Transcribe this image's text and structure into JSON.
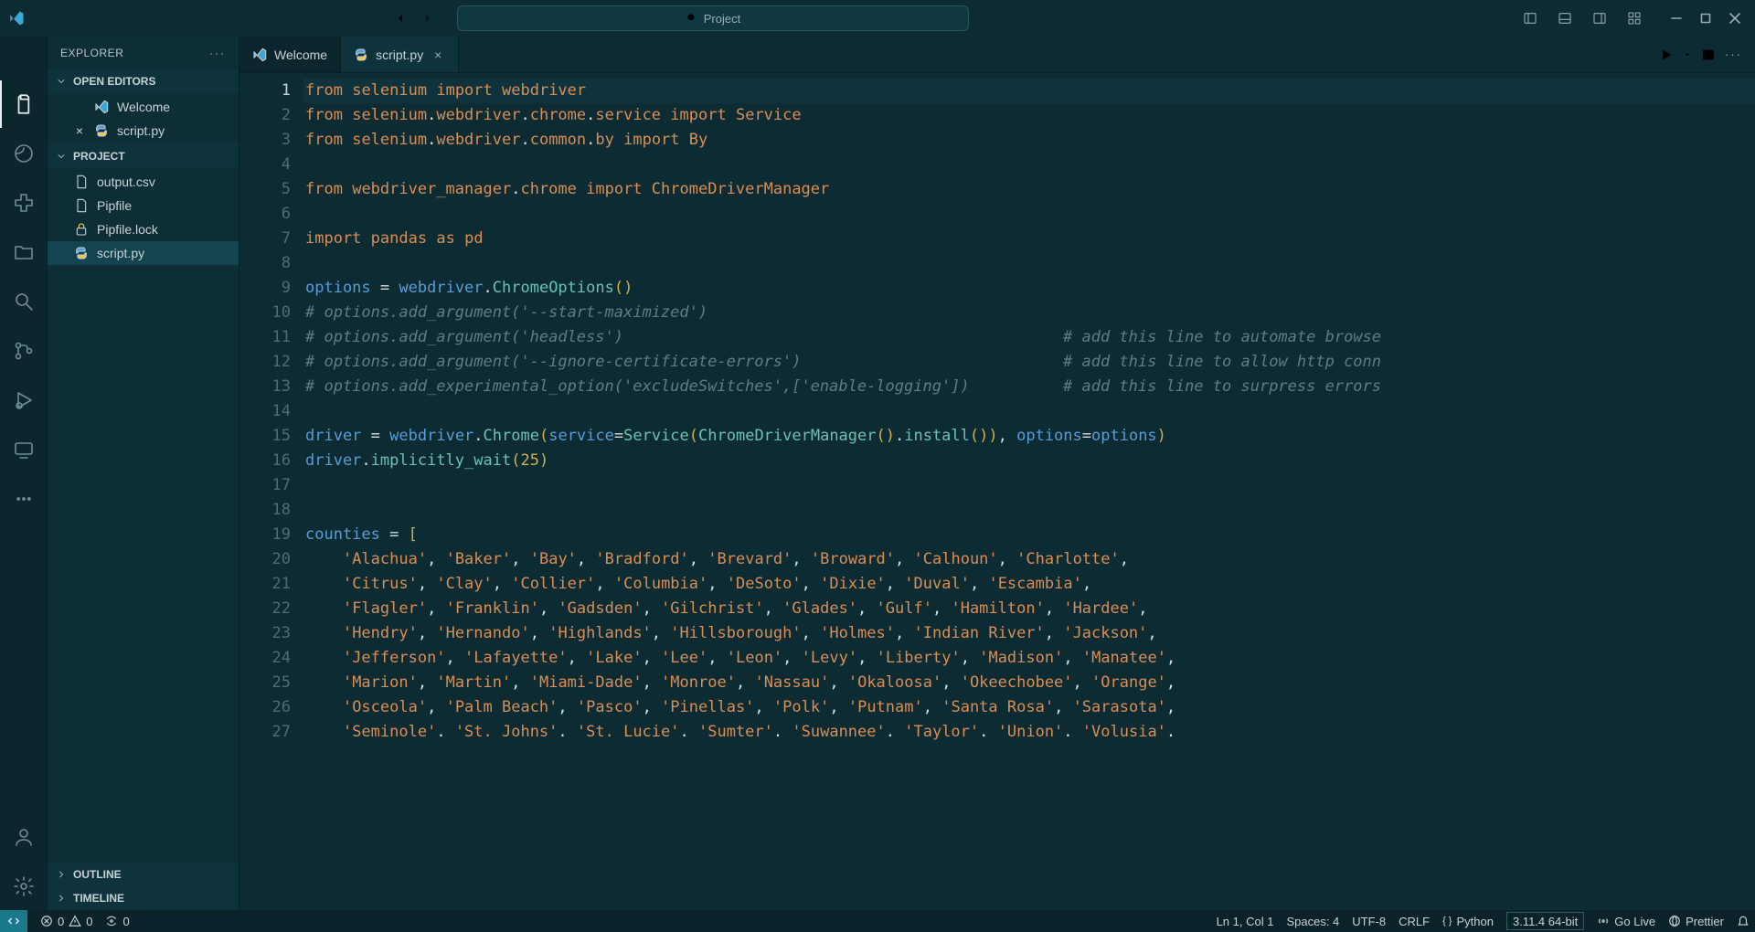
{
  "title_search_placeholder": "Project",
  "tabs": [
    {
      "label": "Welcome",
      "icon": "vscode",
      "active": false,
      "dirty": false
    },
    {
      "label": "script.py",
      "icon": "python",
      "active": true,
      "dirty": false
    }
  ],
  "sidebar": {
    "title": "EXPLORER",
    "sections": {
      "open_editors": {
        "label": "OPEN EDITORS",
        "items": [
          {
            "label": "Welcome",
            "icon": "vscode",
            "closable": false
          },
          {
            "label": "script.py",
            "icon": "python",
            "closable": true
          }
        ]
      },
      "project": {
        "label": "PROJECT",
        "items": [
          {
            "label": "output.csv",
            "icon": "csv"
          },
          {
            "label": "Pipfile",
            "icon": "pipfile"
          },
          {
            "label": "Pipfile.lock",
            "icon": "lock"
          },
          {
            "label": "script.py",
            "icon": "python",
            "active": true
          }
        ]
      },
      "outline": {
        "label": "OUTLINE"
      },
      "timeline": {
        "label": "TIMELINE"
      }
    }
  },
  "activity": {
    "items": [
      "menu",
      "explorer",
      "edge",
      "python",
      "folder",
      "search",
      "scm",
      "debug",
      "remote",
      "more"
    ],
    "bottom": [
      "account",
      "settings"
    ]
  },
  "editor": {
    "current_line": 1,
    "lines": [
      {
        "n": 1,
        "html": "<span class='kw'>from</span> <span class='mod'>selenium</span> <span class='kw'>import</span> <span class='mod'>webdriver</span>"
      },
      {
        "n": 2,
        "html": "<span class='kw'>from</span> <span class='mod'>selenium</span><span class='op'>.</span><span class='mod'>webdriver</span><span class='op'>.</span><span class='mod'>chrome</span><span class='op'>.</span><span class='mod'>service</span> <span class='kw'>import</span> <span class='mod'>Service</span>"
      },
      {
        "n": 3,
        "html": "<span class='kw'>from</span> <span class='mod'>selenium</span><span class='op'>.</span><span class='mod'>webdriver</span><span class='op'>.</span><span class='mod'>common</span><span class='op'>.</span><span class='mod'>by</span> <span class='kw'>import</span> <span class='mod'>By</span>"
      },
      {
        "n": 4,
        "html": ""
      },
      {
        "n": 5,
        "html": "<span class='kw'>from</span> <span class='mod'>webdriver_manager</span><span class='op'>.</span><span class='mod'>chrome</span> <span class='kw'>import</span> <span class='mod'>ChromeDriverManager</span>"
      },
      {
        "n": 6,
        "html": ""
      },
      {
        "n": 7,
        "html": "<span class='kw'>import</span> <span class='mod'>pandas</span> <span class='kw'>as</span> <span class='mod'>pd</span>"
      },
      {
        "n": 8,
        "html": ""
      },
      {
        "n": 9,
        "html": "<span class='name'>options</span> <span class='op'>=</span> <span class='name'>webdriver</span><span class='op'>.</span><span class='func'>ChromeOptions</span><span class='punct'>()</span>"
      },
      {
        "n": 10,
        "html": "<span class='cmt'># options.add_argument('--start-maximized')</span>"
      },
      {
        "n": 11,
        "html": "<span class='cmt'># options.add_argument('headless')                                               # add this line to automate browse</span>"
      },
      {
        "n": 12,
        "html": "<span class='cmt'># options.add_argument('--ignore-certificate-errors')                            # add this line to allow http conn</span>"
      },
      {
        "n": 13,
        "html": "<span class='cmt'># options.add_experimental_option('excludeSwitches',['enable-logging'])          # add this line to surpress errors</span>"
      },
      {
        "n": 14,
        "html": ""
      },
      {
        "n": 15,
        "html": "<span class='name'>driver</span> <span class='op'>=</span> <span class='name'>webdriver</span><span class='op'>.</span><span class='func'>Chrome</span><span class='punct'>(</span><span class='name'>service</span><span class='op'>=</span><span class='func'>Service</span><span class='punct'>(</span><span class='func'>ChromeDriverManager</span><span class='punct'>()</span><span class='op'>.</span><span class='func'>install</span><span class='punct'>())</span><span class='op'>,</span> <span class='name'>options</span><span class='op'>=</span><span class='name'>options</span><span class='punct'>)</span>"
      },
      {
        "n": 16,
        "html": "<span class='name'>driver</span><span class='op'>.</span><span class='func'>implicitly_wait</span><span class='punct'>(</span><span class='num'>25</span><span class='punct'>)</span>"
      },
      {
        "n": 17,
        "html": ""
      },
      {
        "n": 18,
        "html": ""
      },
      {
        "n": 19,
        "html": "<span class='name'>counties</span> <span class='op'>=</span> <span class='punct'>[</span>"
      },
      {
        "n": 20,
        "html": "    <span class='str'>'Alachua'</span><span class='op'>,</span> <span class='str'>'Baker'</span><span class='op'>,</span> <span class='str'>'Bay'</span><span class='op'>,</span> <span class='str'>'Bradford'</span><span class='op'>,</span> <span class='str'>'Brevard'</span><span class='op'>,</span> <span class='str'>'Broward'</span><span class='op'>,</span> <span class='str'>'Calhoun'</span><span class='op'>,</span> <span class='str'>'Charlotte'</span><span class='op'>,</span>"
      },
      {
        "n": 21,
        "html": "    <span class='str'>'Citrus'</span><span class='op'>,</span> <span class='str'>'Clay'</span><span class='op'>,</span> <span class='str'>'Collier'</span><span class='op'>,</span> <span class='str'>'Columbia'</span><span class='op'>,</span> <span class='str'>'DeSoto'</span><span class='op'>,</span> <span class='str'>'Dixie'</span><span class='op'>,</span> <span class='str'>'Duval'</span><span class='op'>,</span> <span class='str'>'Escambia'</span><span class='op'>,</span>"
      },
      {
        "n": 22,
        "html": "    <span class='str'>'Flagler'</span><span class='op'>,</span> <span class='str'>'Franklin'</span><span class='op'>,</span> <span class='str'>'Gadsden'</span><span class='op'>,</span> <span class='str'>'Gilchrist'</span><span class='op'>,</span> <span class='str'>'Glades'</span><span class='op'>,</span> <span class='str'>'Gulf'</span><span class='op'>,</span> <span class='str'>'Hamilton'</span><span class='op'>,</span> <span class='str'>'Hardee'</span><span class='op'>,</span>"
      },
      {
        "n": 23,
        "html": "    <span class='str'>'Hendry'</span><span class='op'>,</span> <span class='str'>'Hernando'</span><span class='op'>,</span> <span class='str'>'Highlands'</span><span class='op'>,</span> <span class='str'>'Hillsborough'</span><span class='op'>,</span> <span class='str'>'Holmes'</span><span class='op'>,</span> <span class='str'>'Indian River'</span><span class='op'>,</span> <span class='str'>'Jackson'</span><span class='op'>,</span>"
      },
      {
        "n": 24,
        "html": "    <span class='str'>'Jefferson'</span><span class='op'>,</span> <span class='str'>'Lafayette'</span><span class='op'>,</span> <span class='str'>'Lake'</span><span class='op'>,</span> <span class='str'>'Lee'</span><span class='op'>,</span> <span class='str'>'Leon'</span><span class='op'>,</span> <span class='str'>'Levy'</span><span class='op'>,</span> <span class='str'>'Liberty'</span><span class='op'>,</span> <span class='str'>'Madison'</span><span class='op'>,</span> <span class='str'>'Manatee'</span><span class='op'>,</span>"
      },
      {
        "n": 25,
        "html": "    <span class='str'>'Marion'</span><span class='op'>,</span> <span class='str'>'Martin'</span><span class='op'>,</span> <span class='str'>'Miami-Dade'</span><span class='op'>,</span> <span class='str'>'Monroe'</span><span class='op'>,</span> <span class='str'>'Nassau'</span><span class='op'>,</span> <span class='str'>'Okaloosa'</span><span class='op'>,</span> <span class='str'>'Okeechobee'</span><span class='op'>,</span> <span class='str'>'Orange'</span><span class='op'>,</span>"
      },
      {
        "n": 26,
        "html": "    <span class='str'>'Osceola'</span><span class='op'>,</span> <span class='str'>'Palm Beach'</span><span class='op'>,</span> <span class='str'>'Pasco'</span><span class='op'>,</span> <span class='str'>'Pinellas'</span><span class='op'>,</span> <span class='str'>'Polk'</span><span class='op'>,</span> <span class='str'>'Putnam'</span><span class='op'>,</span> <span class='str'>'Santa Rosa'</span><span class='op'>,</span> <span class='str'>'Sarasota'</span><span class='op'>,</span>"
      },
      {
        "n": 27,
        "html": "    <span class='str'>'Seminole'</span><span class='op'>.</span> <span class='str'>'St. Johns'</span><span class='op'>.</span> <span class='str'>'St. Lucie'</span><span class='op'>.</span> <span class='str'>'Sumter'</span><span class='op'>.</span> <span class='str'>'Suwannee'</span><span class='op'>.</span> <span class='str'>'Taylor'</span><span class='op'>.</span> <span class='str'>'Union'</span><span class='op'>.</span> <span class='str'>'Volusia'</span><span class='op'>.</span>"
      }
    ]
  },
  "statusbar": {
    "errors": "0",
    "warnings": "0",
    "ports": "0",
    "cursor": "Ln 1, Col 1",
    "spaces": "Spaces: 4",
    "encoding": "UTF-8",
    "eol": "CRLF",
    "lang": "Python",
    "interpreter": "3.11.4 64-bit",
    "golive": "Go Live",
    "formatter": "Prettier"
  },
  "colors": {
    "accent": "#1a7a8c",
    "bg": "#0d2b33"
  }
}
